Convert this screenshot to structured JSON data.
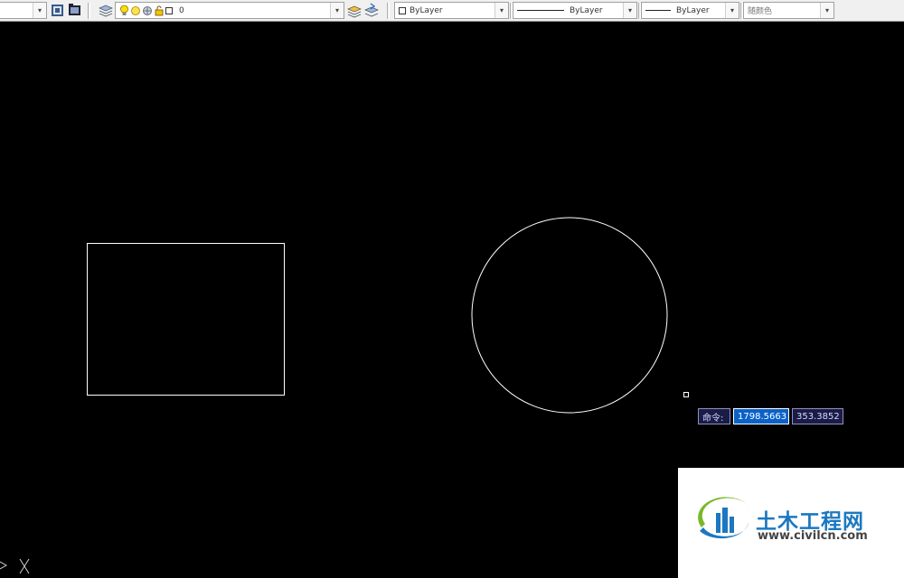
{
  "toolbar": {
    "layer": {
      "name": "0"
    },
    "color": {
      "value": "ByLayer"
    },
    "linetype": {
      "value": "ByLayer"
    },
    "lineweight": {
      "value": "ByLayer"
    },
    "plotstyle": {
      "value": "随颜色"
    }
  },
  "drawing": {
    "background": "#000000",
    "stroke": "#ffffff",
    "objects": [
      "rectangle",
      "circle"
    ]
  },
  "dynamic_input": {
    "prompt": "命令:",
    "x_value": "1798.5663",
    "y_value": "353.3852"
  },
  "watermark": {
    "title": "土木工程网",
    "url": "www.civilcn.com"
  },
  "colors": {
    "toolbar_bg": "#f0f0f0",
    "input_active": "#0a62c8",
    "input_bg": "#1b1b48",
    "watermark_blue": "#1b78c0",
    "watermark_green": "#7ab828"
  }
}
